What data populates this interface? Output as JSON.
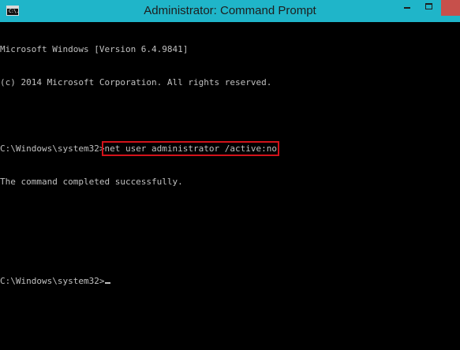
{
  "window": {
    "title": "Administrator: Command Prompt",
    "icon_label": "C:\\.",
    "titlebar_color": "#1fb5c9",
    "close_color": "#c7504b"
  },
  "console": {
    "banner": [
      "Microsoft Windows [Version 6.4.9841]",
      "(c) 2014 Microsoft Corporation. All rights reserved."
    ],
    "prompt1": "C:\\Windows\\system32>",
    "command": "net user administrator /active:no",
    "output": "The command completed successfully.",
    "prompt2": "C:\\Windows\\system32>",
    "highlight_color": "#d3121a",
    "text_color": "#c0c0c0"
  }
}
